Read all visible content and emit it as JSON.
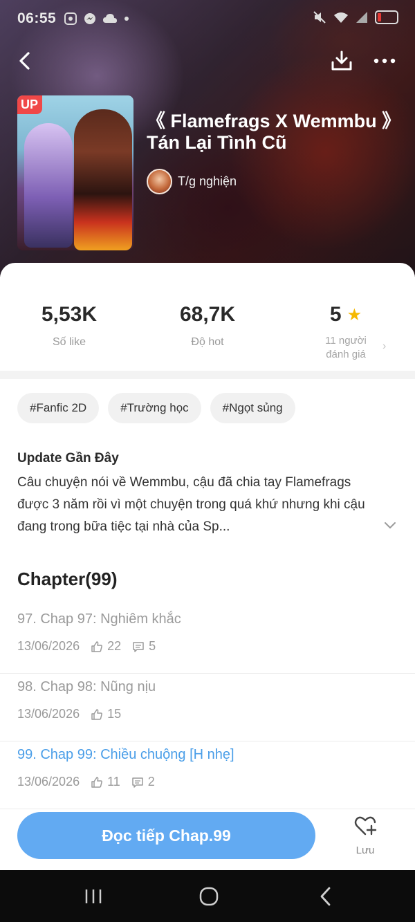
{
  "status_bar": {
    "time": "06:55",
    "left_icons": [
      "screenshot-icon",
      "messenger-icon",
      "cloud-icon",
      "dot-icon"
    ],
    "right_icons": [
      "mute-icon",
      "wifi-icon",
      "signal-icon",
      "battery-icon"
    ],
    "battery_color": "#e53935"
  },
  "header": {
    "cover_badge": "UP",
    "title": "《 Flamefrags X Wemmbu 》Tán Lại Tình Cũ",
    "author": "T/g nghiện"
  },
  "stats": {
    "likes": {
      "value": "5,53K",
      "label": "Số like"
    },
    "hot": {
      "value": "68,7K",
      "label": "Độ hot"
    },
    "rating": {
      "value": "5",
      "label": "11 người đánh giá"
    }
  },
  "tags": [
    "#Fanfic 2D",
    "#Trường học",
    "#Ngọt sủng"
  ],
  "update": {
    "heading": "Update Gần Đây",
    "description": "Câu chuyện nói về Wemmbu, cậu đã chia tay Flamefrags được 3 năm rồi vì một chuyện trong quá khứ nhưng khi cậu đang trong bữa tiệc tại nhà của Sp..."
  },
  "chapters": {
    "heading": "Chapter(99)",
    "items": [
      {
        "name": "97. Chap 97: Nghiêm khắc",
        "date": "13/06/2026",
        "likes": "22",
        "comments": "5",
        "current": false
      },
      {
        "name": "98. Chap 98: Nũng nịu",
        "date": "13/06/2026",
        "likes": "15",
        "comments": null,
        "current": false
      },
      {
        "name": "99. Chap 99: Chiều chuộng [H nhẹ]",
        "date": "13/06/2026",
        "likes": "11",
        "comments": "2",
        "current": true
      }
    ]
  },
  "actions": {
    "read_button": "Đọc tiếp Chap.99",
    "save_label": "Lưu"
  },
  "colors": {
    "accent": "#62aaf2",
    "current_chapter": "#4a9ee8",
    "star": "#f5b800",
    "badge": "#f04848"
  }
}
